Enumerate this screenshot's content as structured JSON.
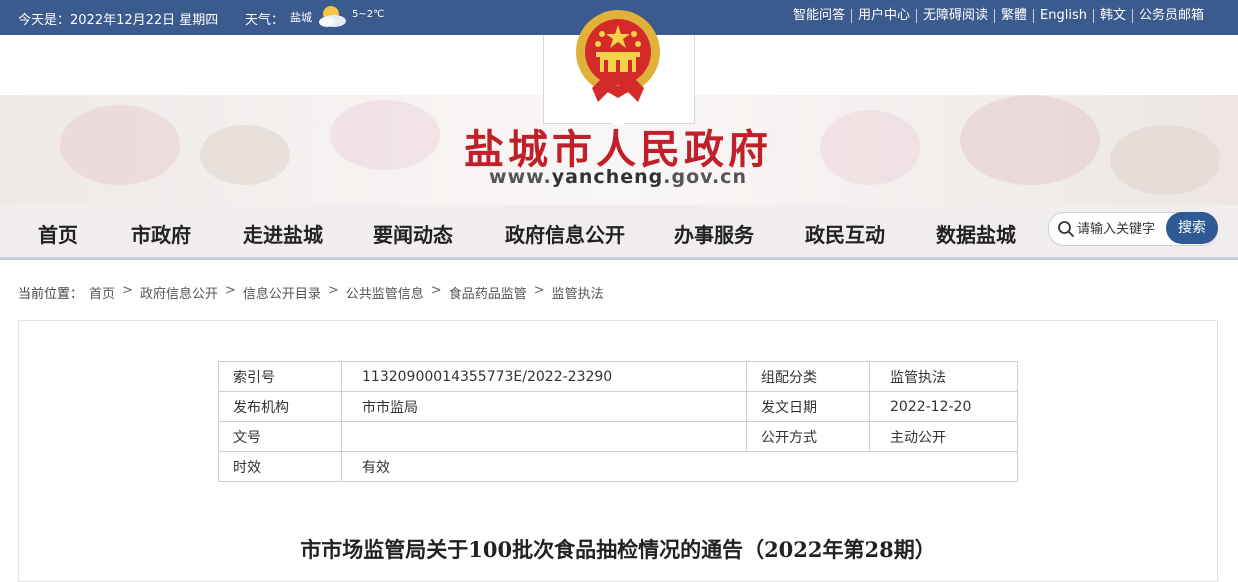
{
  "topbar": {
    "date": "今天是：2022年12月22日 星期四",
    "weather_label": "天气：",
    "city": "盐城",
    "temperature": "5~2℃",
    "links": [
      "智能问答",
      "用户中心",
      "无障碍阅读",
      "繁體",
      "English",
      "韩文",
      "公务员邮箱"
    ]
  },
  "header": {
    "title": "盐城市人民政府",
    "url_prefix": "www.",
    "url_highlight": "yancheng",
    "url_suffix": ".gov.cn"
  },
  "nav": {
    "items": [
      "首页",
      "市政府",
      "走进盐城",
      "要闻动态",
      "政府信息公开",
      "办事服务",
      "政民互动",
      "数据盐城"
    ],
    "search_placeholder": "请输入关键字",
    "search_button": "搜索"
  },
  "breadcrumb": {
    "label": "当前位置：",
    "items": [
      "首页",
      "政府信息公开",
      "信息公开目录",
      "公共监管信息",
      "食品药品监管",
      "监管执法"
    ],
    "separator": ">"
  },
  "meta": {
    "rows": [
      {
        "k1": "索引号",
        "v1": "11320900014355773E/2022-23290",
        "k2": "组配分类",
        "v2": "监管执法"
      },
      {
        "k1": "发布机构",
        "v1": "市市监局",
        "k2": "发文日期",
        "v2": "2022-12-20"
      },
      {
        "k1": "文号",
        "v1": "",
        "k2": "公开方式",
        "v2": "主动公开"
      },
      {
        "k1": "时效",
        "v1": "有效"
      }
    ]
  },
  "article": {
    "title": "市市场监管局关于100批次食品抽检情况的通告（2022年第28期）"
  },
  "colors": {
    "topbar": "#3b5a8e",
    "title_red": "#c0202a",
    "search_button": "#2f5a93"
  }
}
